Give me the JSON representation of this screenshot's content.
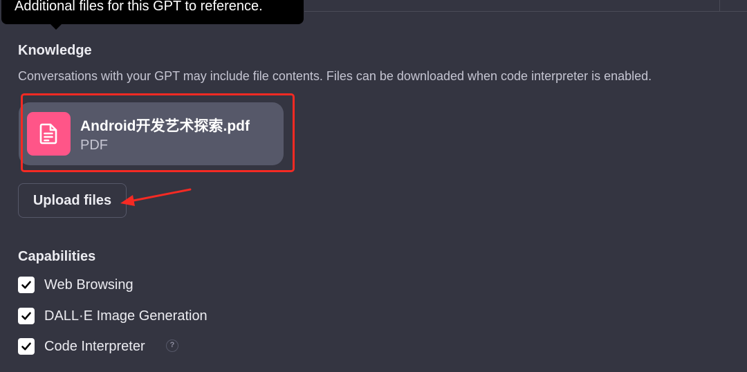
{
  "tooltip": {
    "text": "Additional files for this GPT to reference."
  },
  "knowledge": {
    "title": "Knowledge",
    "description": "Conversations with your GPT may include file contents. Files can be downloaded when code interpreter is enabled.",
    "files": [
      {
        "name": "Android开发艺术探索.pdf",
        "type": "PDF",
        "icon": "document-icon",
        "icon_color": "#ff5588"
      }
    ],
    "upload_button_label": "Upload files"
  },
  "capabilities": {
    "title": "Capabilities",
    "items": [
      {
        "label": "Web Browsing",
        "checked": true
      },
      {
        "label": "DALL·E Image Generation",
        "checked": true
      },
      {
        "label": "Code Interpreter",
        "checked": true,
        "help_icon": "question-mark-icon",
        "help_symbol": "?"
      }
    ]
  },
  "annotations": {
    "highlight_color": "#f52a23"
  },
  "colors": {
    "background": "#343541",
    "card": "#565869",
    "text": "#ececf1"
  }
}
